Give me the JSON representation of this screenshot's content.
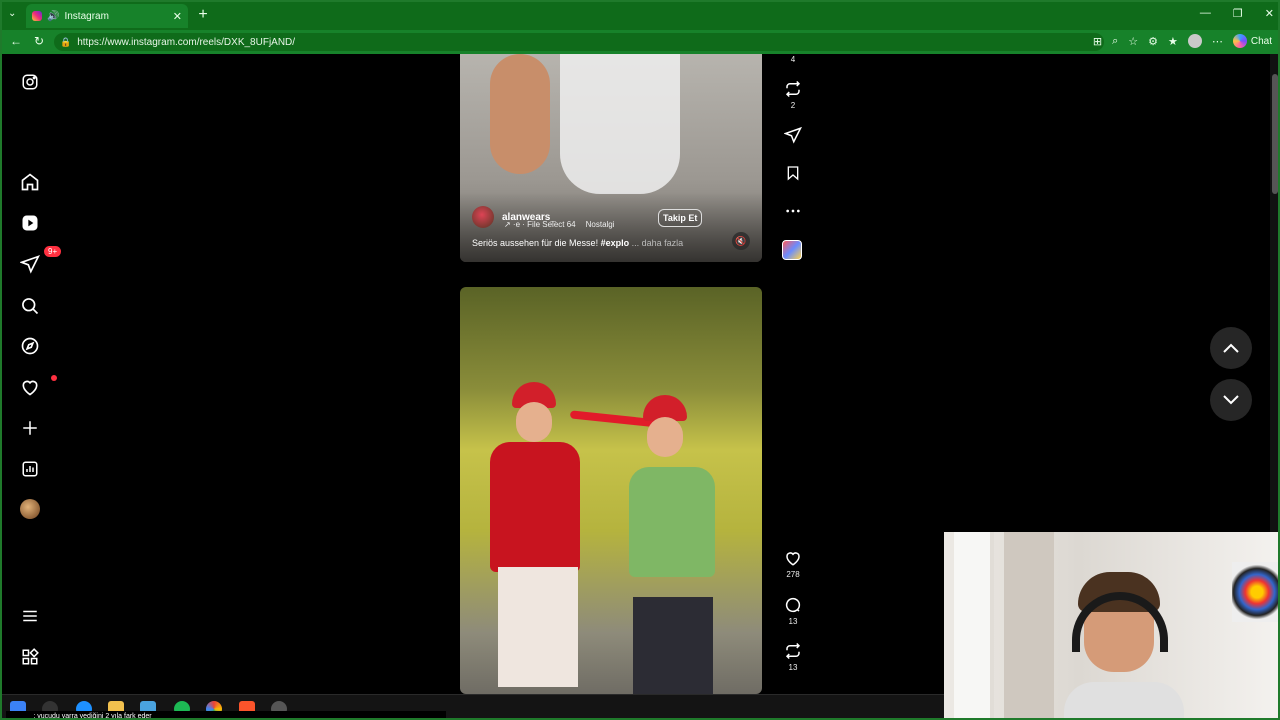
{
  "browser": {
    "tab_title": "Instagram",
    "url": "https://www.instagram.com/reels/DXK_8UFjAND/",
    "chat_label": "Chat"
  },
  "leftnav": {
    "notifications_badge": "9+"
  },
  "reel1": {
    "author": "alanwears_",
    "audio_prefix": "↗ ·e · File Select 64",
    "audio_second": "Nostalgi",
    "follow_label": "Takip Et",
    "caption_text": "Seriös aussehen für die Messe! ",
    "caption_hashtag": "#explo",
    "more_label": "... daha fazla"
  },
  "reel1_actions": {
    "top_count": "4",
    "repost_count": "2"
  },
  "reel2_actions": {
    "likes": "278",
    "comments": "13",
    "reposts": "13"
  },
  "taskbar": {
    "ticker_user": "______",
    "ticker_text": ": vucudu yarra yediğini 2 yıla fark eder"
  },
  "icons": [
    "instagram-icon",
    "home-icon",
    "reels-icon",
    "messages-icon",
    "search-icon",
    "explore-icon",
    "heart-icon",
    "create-icon",
    "dashboard-icon",
    "menu-icon",
    "more-apps-icon",
    "repost-icon",
    "share-icon",
    "bookmark-icon",
    "more-icon",
    "comment-icon",
    "chevron-up-icon",
    "chevron-down-icon"
  ]
}
